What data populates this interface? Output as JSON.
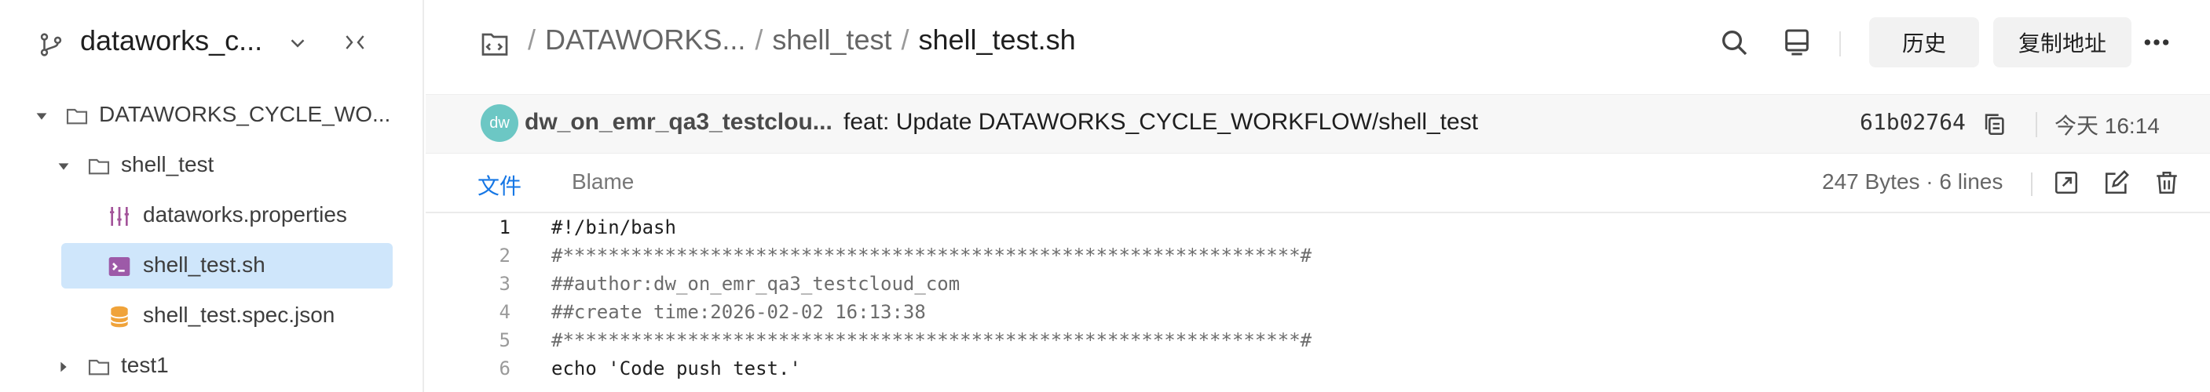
{
  "sidebar": {
    "repo_name": "dataworks_c...",
    "tree": [
      {
        "label": "DATAWORKS_CYCLE_WO...",
        "type": "folder",
        "expanded": true,
        "icon": "folder-icon"
      },
      {
        "label": "shell_test",
        "type": "folder",
        "expanded": true,
        "icon": "folder-icon"
      },
      {
        "label": "dataworks.properties",
        "type": "file",
        "icon": "properties-icon"
      },
      {
        "label": "shell_test.sh",
        "type": "file",
        "icon": "shell-script-icon",
        "selected": true
      },
      {
        "label": "shell_test.spec.json",
        "type": "file",
        "icon": "database-icon"
      },
      {
        "label": "test1",
        "type": "folder",
        "expanded": false,
        "icon": "folder-icon"
      }
    ]
  },
  "header": {
    "breadcrumbs": [
      "DATAWORKS...",
      "shell_test",
      "shell_test.sh"
    ],
    "separator": "/",
    "history_label": "历史",
    "copy_address_label": "复制地址"
  },
  "commit": {
    "avatar_text": "dw",
    "author": "dw_on_emr_qa3_testclou...",
    "message": "feat: Update DATAWORKS_CYCLE_WORKFLOW/shell_test",
    "hash": "61b02764",
    "time": "今天 16:14"
  },
  "file": {
    "tabs": [
      "文件",
      "Blame"
    ],
    "active_tab": "文件",
    "info": "247 Bytes · 6 lines"
  },
  "code": [
    {
      "n": "1",
      "text": "#!/bin/bash"
    },
    {
      "n": "2",
      "text": "#*****************************************************************#"
    },
    {
      "n": "3",
      "text": "##author:dw_on_emr_qa3_testcloud_com"
    },
    {
      "n": "4",
      "text": "##create time:2026-02-02 16:13:38"
    },
    {
      "n": "5",
      "text": "#*****************************************************************#"
    },
    {
      "n": "6",
      "text": "echo 'Code push test.'"
    }
  ],
  "colors": {
    "accent": "#1677e5",
    "selected_bg": "#cfe6fb",
    "avatar_bg": "#6cc7c4",
    "properties_icon": "#a3549a",
    "shell_icon": "#9d5aa8",
    "db_icon": "#f0a33a"
  }
}
